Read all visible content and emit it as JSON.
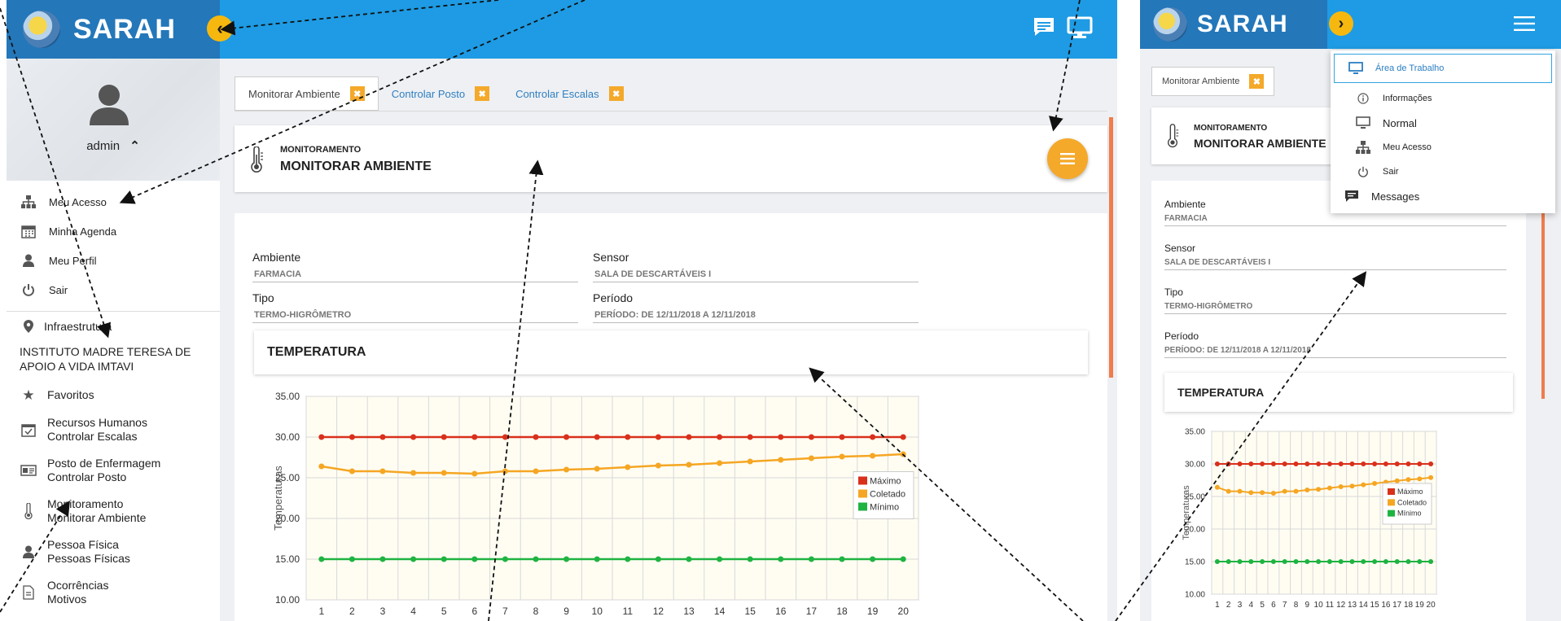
{
  "left": {
    "brand": "SARAH",
    "user": {
      "name": "admin",
      "chevron": "^"
    },
    "user_menu": [
      {
        "icon": "sitemap-icon",
        "label": "Meu Acesso"
      },
      {
        "icon": "calendar-icon",
        "label": "Minha Agenda"
      },
      {
        "icon": "user-icon",
        "label": "Meu Perfil"
      },
      {
        "icon": "power-icon",
        "label": "Sair"
      }
    ],
    "infra_label": "Infraestrutura",
    "org_name": "INSTITUTO MADRE TERESA DE APOIO A VIDA IMTAVI",
    "favorites_label": "Favoritos",
    "nav": [
      {
        "icon": "calendar-check-icon",
        "line1": "Recursos Humanos",
        "line2": "Controlar Escalas"
      },
      {
        "icon": "id-card-icon",
        "line1": "Posto de Enfermagem",
        "line2": "Controlar Posto"
      },
      {
        "icon": "thermometer-icon",
        "line1": "Monitoramento",
        "line2": "Monitorar Ambiente"
      },
      {
        "icon": "user-icon",
        "line1": "Pessoa Física",
        "line2": "Pessoas Físicas"
      },
      {
        "icon": "document-icon",
        "line1": "Ocorrências",
        "line2": "Motivos"
      }
    ],
    "tabs": [
      {
        "label": "Monitorar Ambiente",
        "active": true
      },
      {
        "label": "Controlar Posto",
        "active": false
      },
      {
        "label": "Controlar Escalas",
        "active": false
      }
    ],
    "tab_close": "✖",
    "header": {
      "subtitle": "MONITORAMENTO",
      "title": "MONITORAR AMBIENTE"
    },
    "fields": {
      "ambiente_label": "Ambiente",
      "ambiente_value": "FARMACIA",
      "sensor_label": "Sensor",
      "sensor_value": "SALA DE DESCARTÁVEIS I",
      "tipo_label": "Tipo",
      "tipo_value": "TERMO-HIGRÔMETRO",
      "periodo_label": "Período",
      "periodo_value": "PERÍODO: DE 12/11/2018 A 12/11/2018"
    },
    "section_title": "TEMPERATURA"
  },
  "right": {
    "brand": "SARAH",
    "tab_label": "Monitorar Ambiente",
    "header": {
      "subtitle": "MONITORAMENTO",
      "title": "MONITORAR AMBIENTE"
    },
    "fields": {
      "ambiente_label": "Ambiente",
      "ambiente_value": "FARMACIA",
      "sensor_label": "Sensor",
      "sensor_value": "SALA DE DESCARTÁVEIS I",
      "tipo_label": "Tipo",
      "tipo_value": "TERMO-HIGRÔMETRO",
      "periodo_label": "Período",
      "periodo_value": "PERÍODO: DE 12/11/2018 A 12/11/2018"
    },
    "section_title": "TEMPERATURA",
    "dropdown": [
      {
        "icon": "monitor-icon",
        "label": "Área de Trabalho"
      },
      {
        "icon": "info-icon",
        "label": "Informações"
      },
      {
        "icon": "monitor-icon",
        "label": "Normal"
      },
      {
        "icon": "sitemap-icon",
        "label": "Meu Acesso"
      },
      {
        "icon": "power-icon",
        "label": "Sair"
      },
      {
        "icon": "message-icon",
        "label": "Messages"
      }
    ]
  },
  "colors": {
    "topbar": "#1e9be4",
    "brand": "#2477b9",
    "accent": "#f4a92a",
    "max": "#d9301b",
    "collected": "#f5a623",
    "min": "#1fb341"
  },
  "chart_data": {
    "type": "line",
    "ylabel": "Temperaturas",
    "xlabel": "",
    "ylim": [
      10,
      35
    ],
    "yticks": [
      "10.00",
      "15.00",
      "20.00",
      "25.00",
      "30.00",
      "35.00"
    ],
    "x": [
      1,
      2,
      3,
      4,
      5,
      6,
      7,
      8,
      9,
      10,
      11,
      12,
      13,
      14,
      15,
      16,
      17,
      18,
      19,
      20
    ],
    "grid": true,
    "legend_position": "right",
    "series": [
      {
        "name": "Máximo",
        "color": "#d9301b",
        "values": [
          30,
          30,
          30,
          30,
          30,
          30,
          30,
          30,
          30,
          30,
          30,
          30,
          30,
          30,
          30,
          30,
          30,
          30,
          30,
          30
        ]
      },
      {
        "name": "Coletado",
        "color": "#f5a623",
        "values": [
          26.4,
          25.8,
          25.8,
          25.6,
          25.6,
          25.5,
          25.8,
          25.8,
          26.0,
          26.1,
          26.3,
          26.5,
          26.6,
          26.8,
          27.0,
          27.2,
          27.4,
          27.6,
          27.7,
          27.9
        ]
      },
      {
        "name": "Mínimo",
        "color": "#1fb341",
        "values": [
          15,
          15,
          15,
          15,
          15,
          15,
          15,
          15,
          15,
          15,
          15,
          15,
          15,
          15,
          15,
          15,
          15,
          15,
          15,
          15
        ]
      }
    ]
  }
}
